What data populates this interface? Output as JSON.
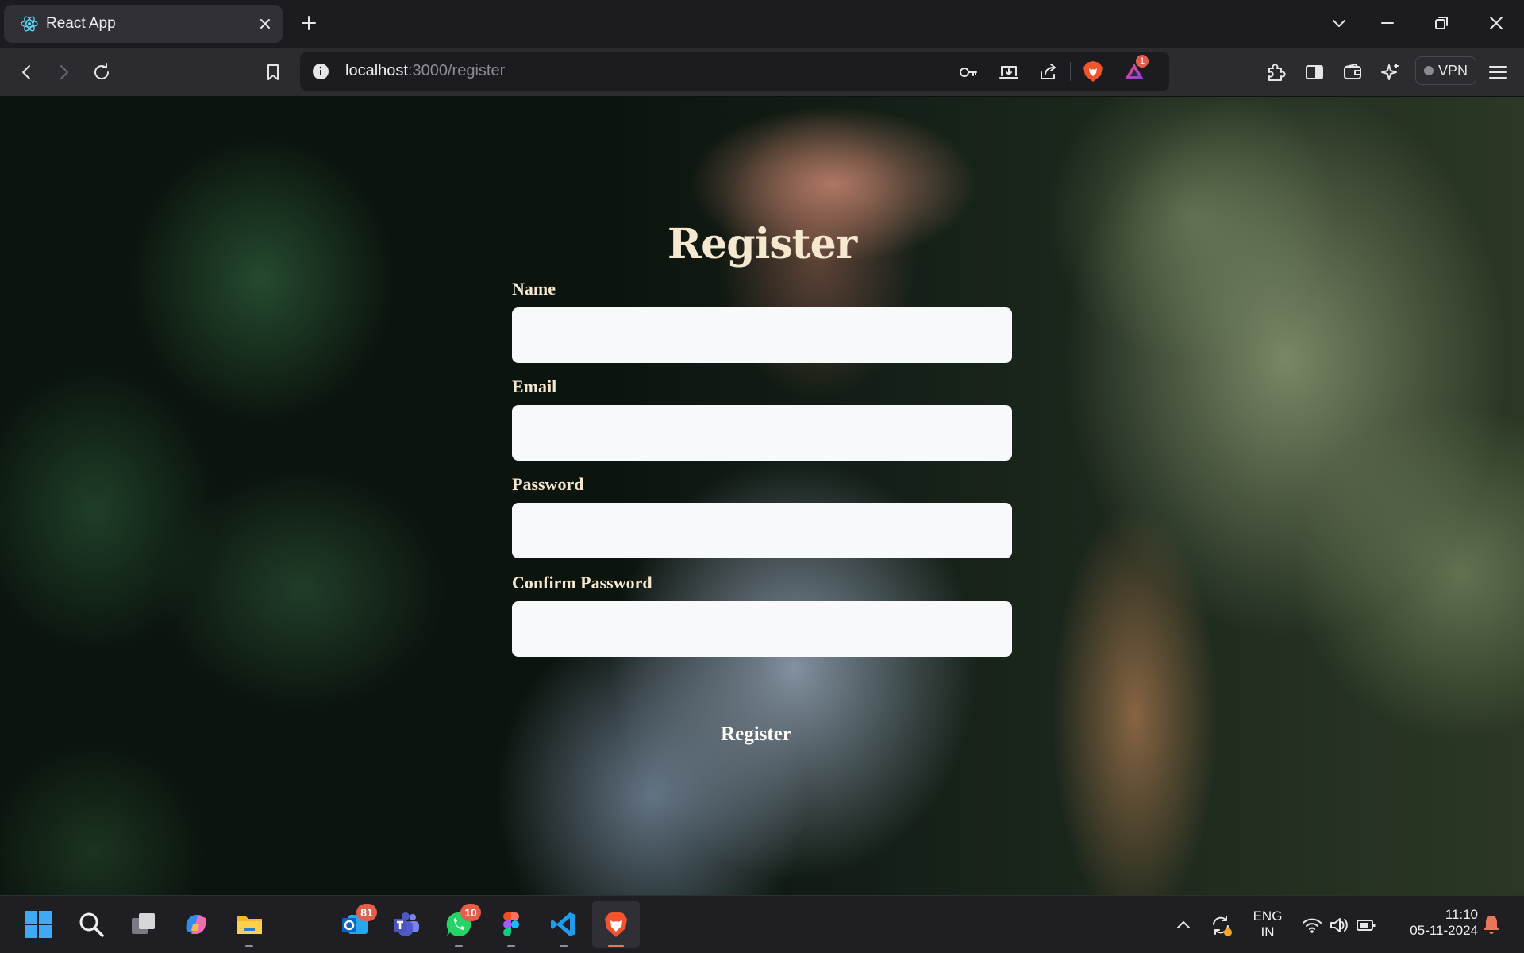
{
  "browser": {
    "tab": {
      "title": "React App",
      "favicon": "react-logo-icon"
    },
    "url": {
      "host": "localhost",
      "path": ":3000/register"
    },
    "shield_badge_count": "1",
    "vpn_label": "VPN"
  },
  "page": {
    "title": "Register",
    "fields": [
      {
        "label": "Name",
        "value": "",
        "placeholder": ""
      },
      {
        "label": "Email",
        "value": "",
        "placeholder": ""
      },
      {
        "label": "Password",
        "value": "",
        "placeholder": ""
      },
      {
        "label": "Confirm Password",
        "value": "",
        "placeholder": ""
      }
    ],
    "submit_label": "Register"
  },
  "taskbar": {
    "apps": [
      {
        "name": "start",
        "icon": "windows-logo-icon"
      },
      {
        "name": "search",
        "icon": "search-icon"
      },
      {
        "name": "task-view",
        "icon": "task-view-icon"
      },
      {
        "name": "copilot",
        "icon": "copilot-icon"
      },
      {
        "name": "file-explorer",
        "icon": "folder-icon"
      },
      {
        "name": "outlook",
        "icon": "mail-icon",
        "badge": "81"
      },
      {
        "name": "teams",
        "icon": "teams-icon"
      },
      {
        "name": "whatsapp",
        "icon": "whatsapp-icon",
        "badge": "10"
      },
      {
        "name": "figma",
        "icon": "figma-icon"
      },
      {
        "name": "vscode",
        "icon": "vscode-icon"
      },
      {
        "name": "brave",
        "icon": "brave-lion-icon"
      }
    ],
    "tray": {
      "language": "ENG",
      "region": "IN",
      "time": "11:10",
      "date": "05-11-2024"
    }
  },
  "colors": {
    "label_text": "#f5e8cf",
    "input_bg": "#f8f9fa",
    "badge": "#e35d4a",
    "brave_orange": "#f2542d"
  }
}
